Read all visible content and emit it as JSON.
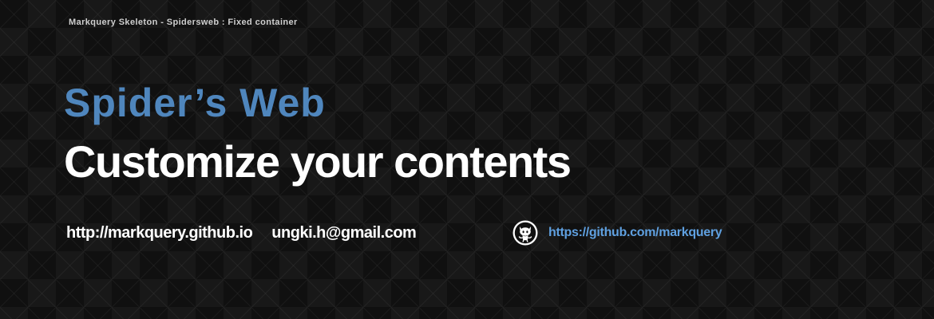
{
  "header": {
    "top_label": "Markquery Skeleton - Spidersweb : Fixed container"
  },
  "hero": {
    "title": "Spider’s Web",
    "subtitle": "Customize your contents"
  },
  "links": {
    "site": "http://markquery.github.io",
    "email": "ungki.h@gmail.com",
    "github": "https://github.com/markquery",
    "github_icon": "github-octocat-icon"
  },
  "colors": {
    "accent": "#4f86bd",
    "link": "#5fa0e0",
    "background": "#101010"
  }
}
